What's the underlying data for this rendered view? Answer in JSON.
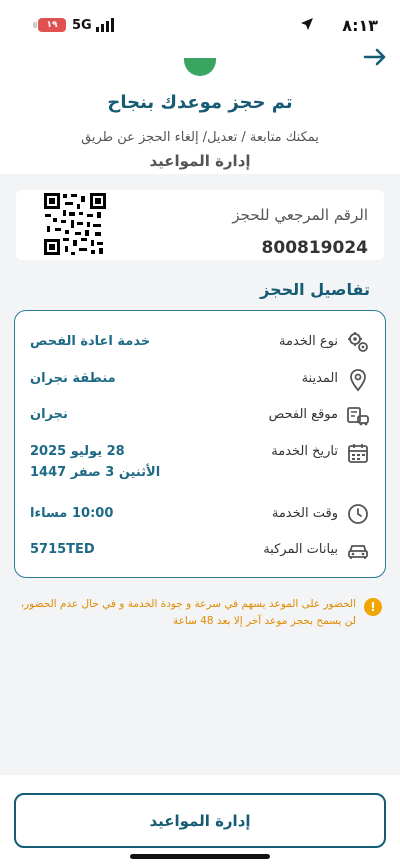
{
  "status_bar": {
    "time": "٨:١٣",
    "network": "5G",
    "battery": "١٩"
  },
  "header": {
    "title": "تم حجز موعدك بنجاح",
    "subtitle": "يمكنك متابعة / تعديل/ إلغاء الحجز عن طريق",
    "subtitle_bold": "إدارة المواعيد"
  },
  "reference": {
    "label": "الرقم المرجعي للحجز",
    "number": "800819024"
  },
  "details": {
    "section_title": "تفاصيل الحجز",
    "service_type": {
      "label": "نوع الخدمة",
      "value": "خدمة اعادة الفحص",
      "icon": "gears-icon"
    },
    "city": {
      "label": "المدينة",
      "value": "منطقة نجران",
      "icon": "location-pin-icon"
    },
    "location": {
      "label": "موقع الفحص",
      "value": "نجران",
      "icon": "inspection-site-icon"
    },
    "date": {
      "label": "تاريخ الخدمة",
      "value": "28 يوليو 2025",
      "value_hijri": "الأثنين 3 صفر 1447",
      "icon": "calendar-icon"
    },
    "time": {
      "label": "وقت الخدمة",
      "value": "10:00",
      "period": "مساءا",
      "icon": "clock-icon"
    },
    "vehicle": {
      "label": "بيانات المركبة",
      "value": "5715TED",
      "icon": "car-icon"
    }
  },
  "notice": {
    "text": "الحضور على الموعد يسهم في سرعة و جودة الخدمة و في حال عدم الحضور، لن يسمح بحجز موعد آخر إلا بعد 48 ساعة"
  },
  "bottom": {
    "manage_button": "إدارة المواعيد"
  },
  "colors": {
    "primary": "#155b74",
    "accent_teal": "#1e6a86",
    "success": "#3aa560",
    "warning": "#f0a500"
  }
}
